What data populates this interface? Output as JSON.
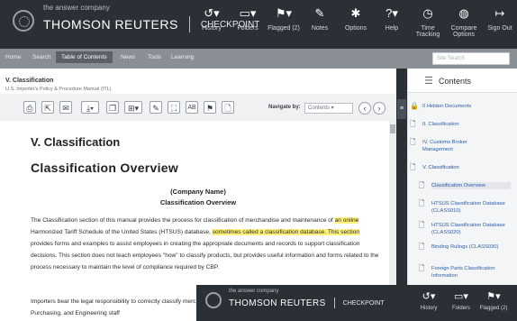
{
  "header": {
    "brand_sub": "the answer company",
    "brand_name": "THOMSON REUTERS",
    "product": "CHECKPOINT",
    "tools": [
      {
        "icon": "history-icon",
        "glyph": "↺▾",
        "label": "History"
      },
      {
        "icon": "folders-icon",
        "glyph": "▭▾",
        "label": "Folders"
      },
      {
        "icon": "flag-icon",
        "glyph": "⚑▾",
        "label": "Flagged (2)"
      },
      {
        "icon": "notes-icon",
        "glyph": "✎",
        "label": "Notes"
      },
      {
        "icon": "gear-icon",
        "glyph": "✱",
        "label": "Options"
      },
      {
        "icon": "help-icon",
        "glyph": "?▾",
        "label": "Help"
      },
      {
        "icon": "clock-icon",
        "glyph": "◷",
        "label": "Time Tracking"
      },
      {
        "icon": "compare-icon",
        "glyph": "◍",
        "label": "Compare Options"
      },
      {
        "icon": "signout-icon",
        "glyph": "↦",
        "label": "Sign Out"
      }
    ]
  },
  "nav": {
    "items": [
      "Home",
      "Search",
      "Table of Contents",
      "News",
      "Tools",
      "Learning"
    ],
    "active_index": 2,
    "search_placeholder": "Site Search"
  },
  "document": {
    "title": "V. Classification",
    "path": "U.S. Importer's Policy & Procedure Manual (ITL)",
    "navigate_by_label": "Navigate by:",
    "navigate_by_value": "Contents",
    "section_title": "V. Classification",
    "overview_title": "Classification Overview",
    "company_name": "(Company Name)",
    "sub_title": "Classification Overview",
    "para1_a": "The Classification section of this manual provides the process for classification of merchandise and maintenance of ",
    "para1_hl1": "an online",
    "para1_b": " Harmonized Tariff Schedule of the United States (HTSUS) database, ",
    "para1_hl2": "sometimes called a classification database. This section",
    "para1_c": " provides forms and examples to assist employees in creating the appropriate documents and records to support classification decisions. This section does not teach employees \"how\" to classify products, but provides useful information and forms related to the process necessary to maintain the level of compliance required by CBP.",
    "para2": "Importers bear the legal responsibility to correctly classify merchandise. Companies must ensure that all import Compliance, Purchasing, and Engineering staff"
  },
  "contents": {
    "title": "Contents",
    "items": [
      {
        "icon": "lock-icon",
        "glyph": "🔒",
        "label": "0 Hidden Documents"
      },
      {
        "icon": "doc-icon",
        "glyph": "🗋",
        "label": "II. Classification"
      },
      {
        "icon": "doc-icon",
        "glyph": "🗋",
        "label": "IV. Customs Broker Management"
      },
      {
        "icon": "doc-icon",
        "glyph": "🗋",
        "label": "V. Classification"
      },
      {
        "icon": "doc-icon",
        "glyph": "🗋",
        "label": "Classification Overview"
      },
      {
        "icon": "doc-icon",
        "glyph": "🗋",
        "label": "HTSUS Classification Database (CLASS010)"
      },
      {
        "icon": "doc-icon",
        "glyph": "🗋",
        "label": "HTSUS Classification Database (CLASS020)"
      },
      {
        "icon": "doc-icon",
        "glyph": "🗋",
        "label": "Binding Rulings (CLASS030)"
      },
      {
        "icon": "doc-icon",
        "glyph": "🗋",
        "label": "Foreign Parts Classification Information"
      }
    ]
  },
  "overlay": {
    "brand_sub": "the answer company",
    "brand_name": "THOMSON REUTERS",
    "product": "CHECKPOINT",
    "tools": [
      {
        "glyph": "↺▾",
        "label": "History"
      },
      {
        "glyph": "▭▾",
        "label": "Folders"
      },
      {
        "glyph": "⚑▾",
        "label": "Flagged (2)"
      }
    ]
  }
}
